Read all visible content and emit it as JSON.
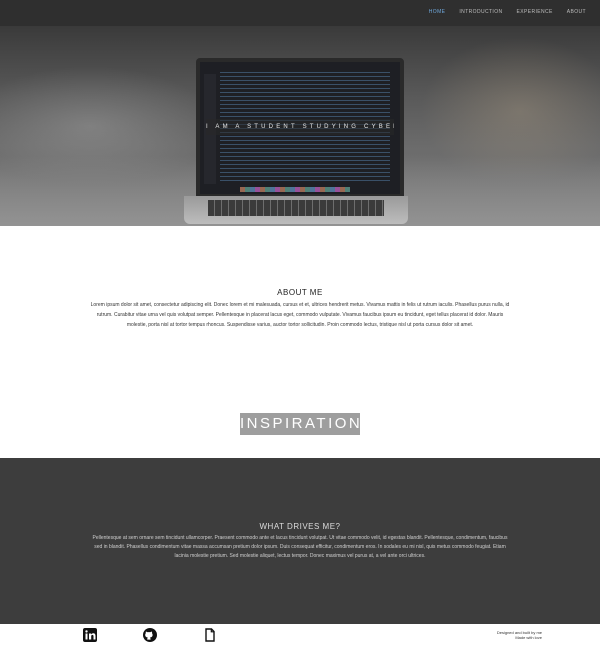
{
  "nav": {
    "items": [
      {
        "label": "Home",
        "active": true
      },
      {
        "label": "Introduction",
        "active": false
      },
      {
        "label": "Experience",
        "active": false
      },
      {
        "label": "About",
        "active": false
      }
    ]
  },
  "hero": {
    "tagline": "I AM A STUDENT STUDYING CYBER SECURITY"
  },
  "about": {
    "title": "ABOUT ME",
    "text": "Lorem ipsum dolor sit amet, consectetur adipiscing elit. Donec lorem et mi malesuada, cursus et et, ultrices hendrerit metus. Vivamus mattis in felis ut rutrum iaculis. Phasellus purus nulla, id rutrum. Curabitur vitae urna vel quis volutpat semper. Pellentesque in placerat lacus eget, commodo vulputate. Vivamus faucibus ipsum eu tincidunt, eget tellus placerat id dolor. Mauris molestie, porta nisl at tortor tempus rhoncus. Suspendisse varius, auctor tortor sollicitudin. Proin commodo lectus, tristique nisl ut porta cursus dolor sit amet."
  },
  "inspiration": {
    "label": "INSPIRATION"
  },
  "drives": {
    "title": "WHAT DRIVES ME?",
    "text": "Pellentesque at sem ornare sem tincidunt ullamcorper. Praesent commodo ante et lacus tincidunt volutpat. Ut vitae commodo velit, id egestas blandit. Pellentesque, condimentum, faucibus sed in blandit. Phasellus condimentum vitae massa accumsan pretium dolor ipsum. Duis consequat efficitur, condimentum eros. In sodales eu mi nisl, quis metus commodo feugiat. Etiam lacinia molestie pretium. Sed molestie aliquet, lectus tempor. Donec maximus vel purus at, a vel ante orci ultrices."
  },
  "footer": {
    "icons": [
      "linkedin-icon",
      "github-icon",
      "document-icon"
    ],
    "copyright_line1": "Designed and built by me",
    "copyright_line2": "Made with love"
  },
  "colors": {
    "nav_bg": "#2f2f2f",
    "nav_active": "#6fa8dc",
    "drives_bg": "#3d3d3d",
    "inspiration_bg": "#9e9e9e"
  }
}
